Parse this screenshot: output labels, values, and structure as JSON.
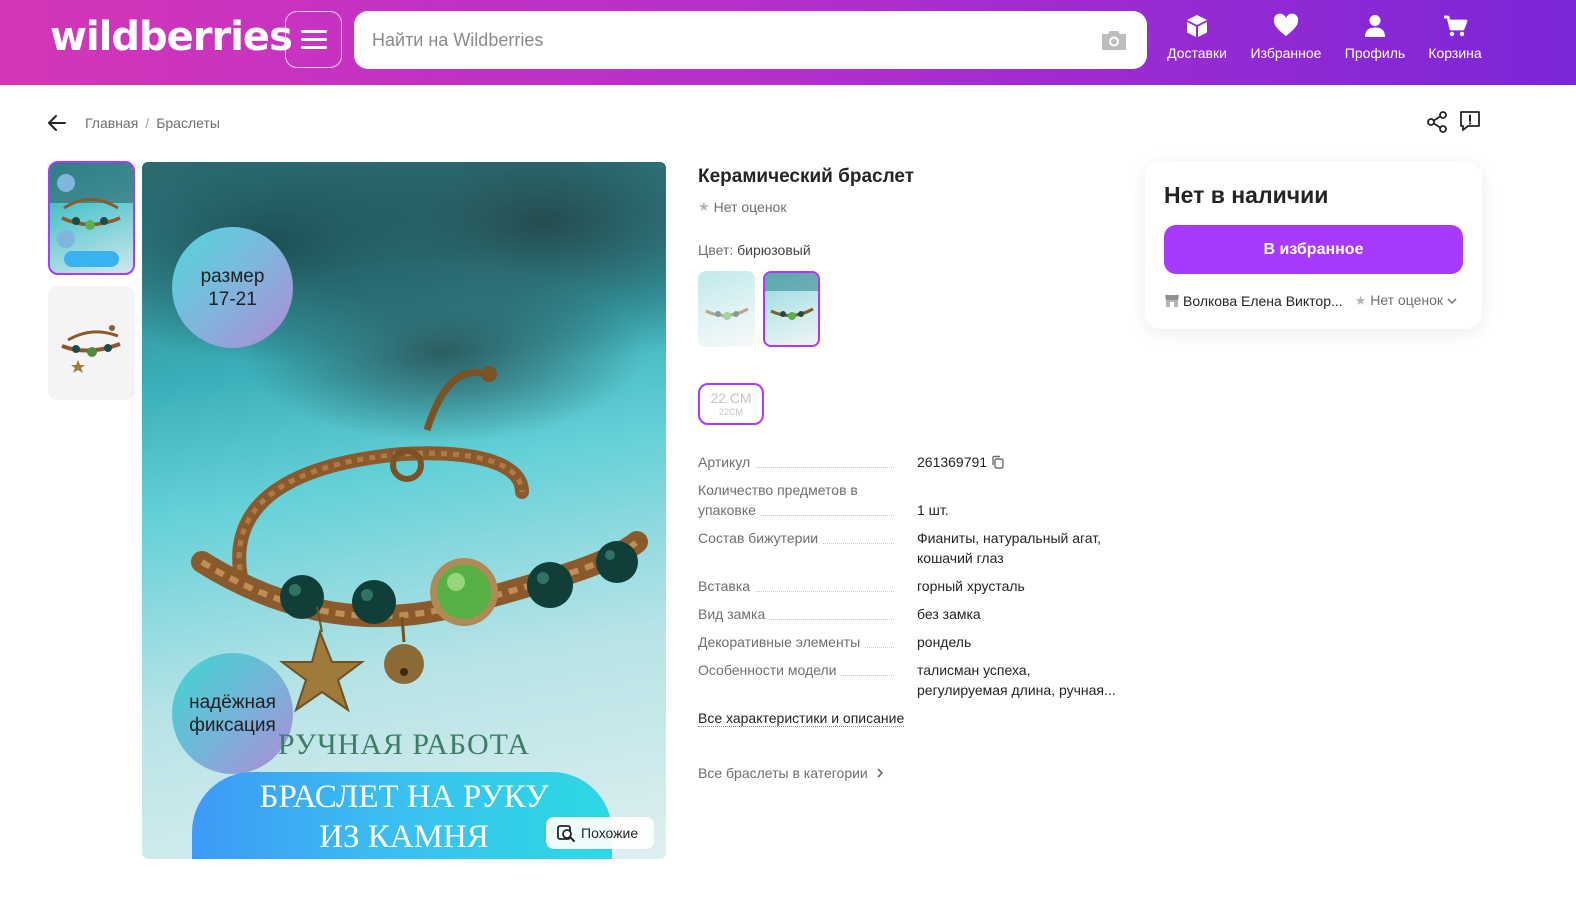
{
  "header": {
    "logo": "wildberries",
    "search_placeholder": "Найти на Wildberries",
    "nav": [
      {
        "label": "Доставки",
        "icon": "box-icon"
      },
      {
        "label": "Избранное",
        "icon": "heart-icon"
      },
      {
        "label": "Профиль",
        "icon": "user-icon"
      },
      {
        "label": "Корзина",
        "icon": "cart-icon"
      }
    ]
  },
  "breadcrumb": [
    "Главная",
    "Браслеты"
  ],
  "gallery": {
    "bubble1": "размер\n17-21",
    "bubble2": "надёжная\nфиксация",
    "caption1": "РУЧНАЯ РАБОТА",
    "caption2_line1": "БРАСЛЕТ НА РУКУ",
    "caption2_line2": "ИЗ КАМНЯ",
    "similar_label": "Похожие"
  },
  "product": {
    "title": "Керамический браслет",
    "rating": "Нет оценок",
    "color_key": "Цвет:",
    "color_value": "бирюзовый",
    "size_big": "22 СМ",
    "size_small": "22СМ",
    "specs": [
      {
        "k": "Артикул",
        "v": "261369791"
      },
      {
        "k": "Количество предметов в упаковке",
        "v": "1 шт."
      },
      {
        "k": "Состав бижутерии",
        "v": "Фианиты, натуральный агат, кошачий глаз"
      },
      {
        "k": "Вставка",
        "v": "горный хрусталь"
      },
      {
        "k": "Вид замка",
        "v": "без замка"
      },
      {
        "k": "Декоративные элементы",
        "v": "рондель"
      },
      {
        "k": "Особенности модели",
        "v": "талисман успеха, регулируемая длина, ручная..."
      }
    ],
    "all_specs_link": "Все характеристики и описание",
    "all_category_link": "Все браслеты в категории"
  },
  "buy_card": {
    "stock_status": "Нет в наличии",
    "favorite_button": "В избранное",
    "seller_name": "Волкова Елена Виктор...",
    "seller_rating": "Нет оценок"
  },
  "colors": {
    "accent": "#a73afd",
    "header_start": "#d336b8",
    "header_end": "#7a26d9"
  }
}
